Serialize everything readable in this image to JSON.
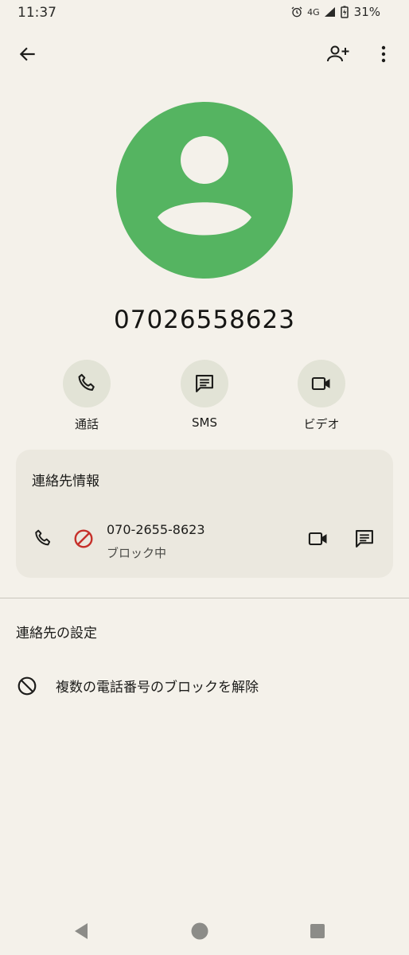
{
  "status_bar": {
    "time": "11:37",
    "network": "4G",
    "battery": "31%",
    "icons": [
      "alarm-icon",
      "signal-icon",
      "battery-charging-icon"
    ]
  },
  "app_bar": {
    "icons": [
      "back-arrow-icon",
      "add-contact-icon",
      "more-vert-icon"
    ]
  },
  "contact": {
    "name": "07026558623",
    "avatar_color": "#55b461"
  },
  "actions": {
    "call_label": "通話",
    "sms_label": "SMS",
    "video_label": "ビデオ"
  },
  "info_card": {
    "title": "連絡先情報",
    "phone_number": "070-2655-8623",
    "status": "ブロック中",
    "block_color": "#c6302a"
  },
  "settings": {
    "title": "連絡先の設定",
    "unblock_label": "複数の電話番号のブロックを解除"
  },
  "nav_bar": {
    "icons": [
      "nav-back-icon",
      "nav-home-icon",
      "nav-recents-icon"
    ]
  }
}
